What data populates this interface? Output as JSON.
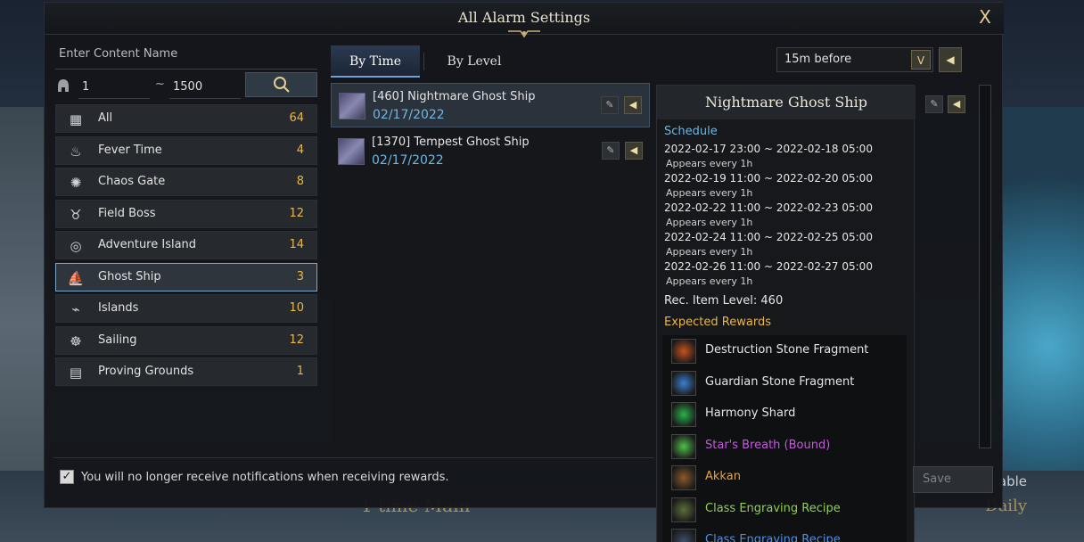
{
  "window": {
    "title": "All Alarm Settings",
    "close_label": "X"
  },
  "filter": {
    "name_label": "Enter Content Name",
    "range_min": "1",
    "range_sep": "~",
    "range_max": "1500"
  },
  "categories": [
    {
      "label": "All",
      "count": "64",
      "icon": "grid-icon",
      "glyph": "▦"
    },
    {
      "label": "Fever Time",
      "count": "4",
      "icon": "flame-icon",
      "glyph": "♨"
    },
    {
      "label": "Chaos Gate",
      "count": "8",
      "icon": "gate-icon",
      "glyph": "✺"
    },
    {
      "label": "Field Boss",
      "count": "12",
      "icon": "horns-icon",
      "glyph": "♉"
    },
    {
      "label": "Adventure Island",
      "count": "14",
      "icon": "shell-icon",
      "glyph": "◎"
    },
    {
      "label": "Ghost Ship",
      "count": "3",
      "icon": "ship-icon",
      "glyph": "⛵"
    },
    {
      "label": "Islands",
      "count": "10",
      "icon": "palm-icon",
      "glyph": "⌁"
    },
    {
      "label": "Sailing",
      "count": "12",
      "icon": "helm-icon",
      "glyph": "☸"
    },
    {
      "label": "Proving Grounds",
      "count": "1",
      "icon": "arena-icon",
      "glyph": "▤"
    }
  ],
  "tabs": {
    "by_time": "By Time",
    "by_level": "By Level"
  },
  "alarm_time": {
    "value": "15m before",
    "arrow": "V"
  },
  "list_items": [
    {
      "name": "[460] Nightmare Ghost Ship",
      "date": "02/17/2022"
    },
    {
      "name": "[1370] Tempest Ghost Ship",
      "date": "02/17/2022"
    }
  ],
  "detail": {
    "title": "Nightmare Ghost Ship",
    "schedule_label": "Schedule",
    "schedule": [
      {
        "range": "2022-02-17 23:00 ~ 2022-02-18 05:00",
        "every": "Appears every 1h"
      },
      {
        "range": "2022-02-19 11:00 ~ 2022-02-20 05:00",
        "every": "Appears every 1h"
      },
      {
        "range": "2022-02-22 11:00 ~ 2022-02-23 05:00",
        "every": "Appears every 1h"
      },
      {
        "range": "2022-02-24 11:00 ~ 2022-02-25 05:00",
        "every": "Appears every 1h"
      },
      {
        "range": "2022-02-26 11:00 ~ 2022-02-27 05:00",
        "every": "Appears every 1h"
      }
    ],
    "rec_level": "Rec. Item Level: 460",
    "rewards_label": "Expected Rewards",
    "rewards": [
      {
        "name": "Destruction Stone Fragment",
        "color": "#e6e6e6",
        "icon": "destruction-stone-icon",
        "swatch": "#c7521f"
      },
      {
        "name": "Guardian Stone Fragment",
        "color": "#e6e6e6",
        "icon": "guardian-stone-icon",
        "swatch": "#3b7fd0"
      },
      {
        "name": "Harmony Shard",
        "color": "#e6e6e6",
        "icon": "harmony-shard-icon",
        "swatch": "#29b34a"
      },
      {
        "name": "Star's Breath (Bound)",
        "color": "#c25ad8",
        "icon": "stars-breath-icon",
        "swatch": "#4fbf4a"
      },
      {
        "name": "Akkan",
        "color": "#e8a33a",
        "icon": "akkan-card-icon",
        "swatch": "#8a5a2a"
      },
      {
        "name": "Class Engraving Recipe",
        "color": "#8fd14f",
        "icon": "engraving-recipe-icon",
        "swatch": "#5c6e3a"
      },
      {
        "name": "Class Engraving Recipe",
        "color": "#4f8fe0",
        "icon": "engraving-recipe-blue-icon",
        "swatch": "#3c4f6a"
      }
    ]
  },
  "footer": {
    "checkbox_mark": "✓",
    "notice": "You will no longer receive notifications when receiving rewards.",
    "save_label": "Save"
  },
  "background": {
    "text_right": "able",
    "text_bottom_left": "1 time Main",
    "text_bottom_right": "Daily"
  }
}
